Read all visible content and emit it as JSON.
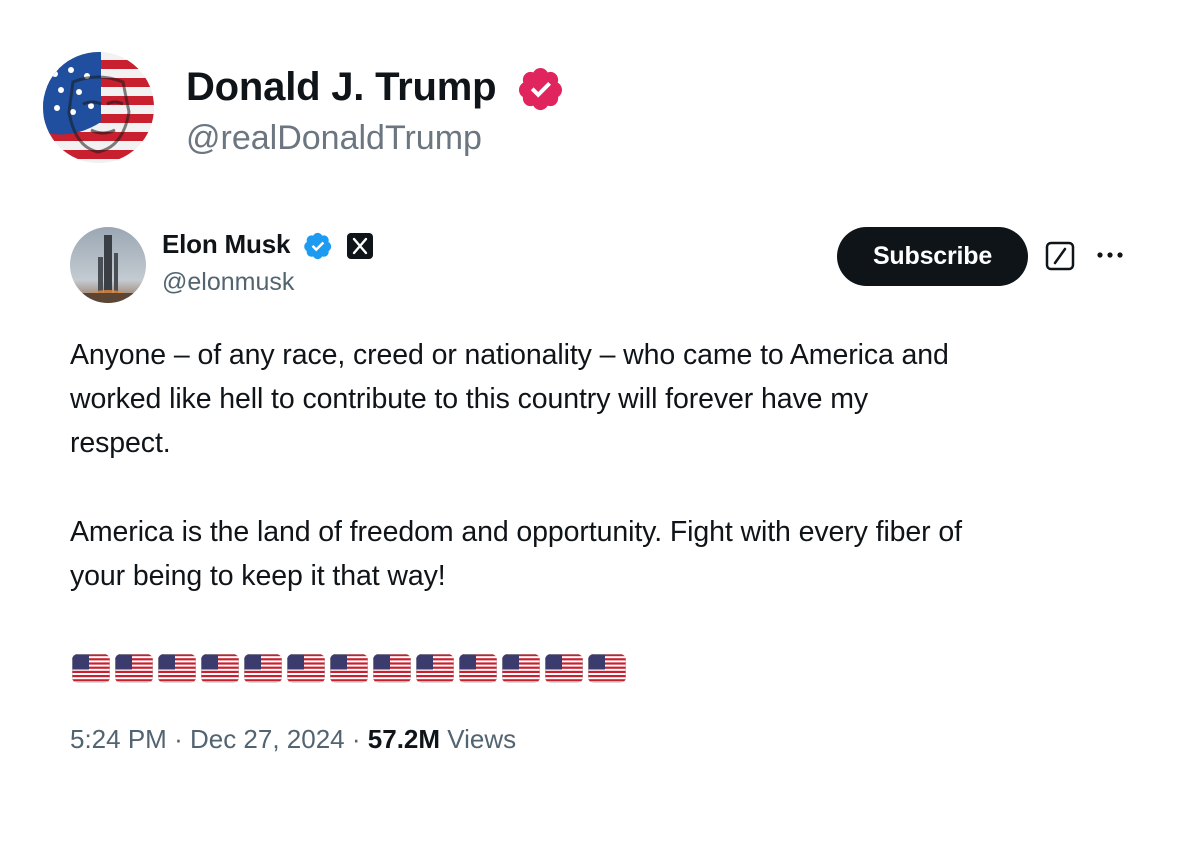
{
  "header": {
    "name": "Donald J. Trump",
    "handle": "@realDonaldTrump",
    "badge_color": "#e0245e",
    "avatar": "stylized-flag-face-avatar"
  },
  "tweet": {
    "author_name": "Elon Musk",
    "author_handle": "@elonmusk",
    "badge_color": "#1d9bf0",
    "affiliation_icon": "x-logo-icon",
    "subscribe_label": "Subscribe",
    "text_lines_p1": [
      "Anyone – of any race, creed or nationality – who came to America and",
      "worked like hell to contribute to this country will forever have my",
      "respect."
    ],
    "text_lines_p2": [
      "America is the land of freedom and opportunity. Fight with every fiber of",
      "your being to keep it that way!"
    ],
    "flag_emoji": "🇺🇸",
    "flag_count": 13,
    "time": "5:24 PM",
    "date": "Dec 27, 2024",
    "separator": "·",
    "views_count": "57.2M",
    "views_label": "Views"
  }
}
